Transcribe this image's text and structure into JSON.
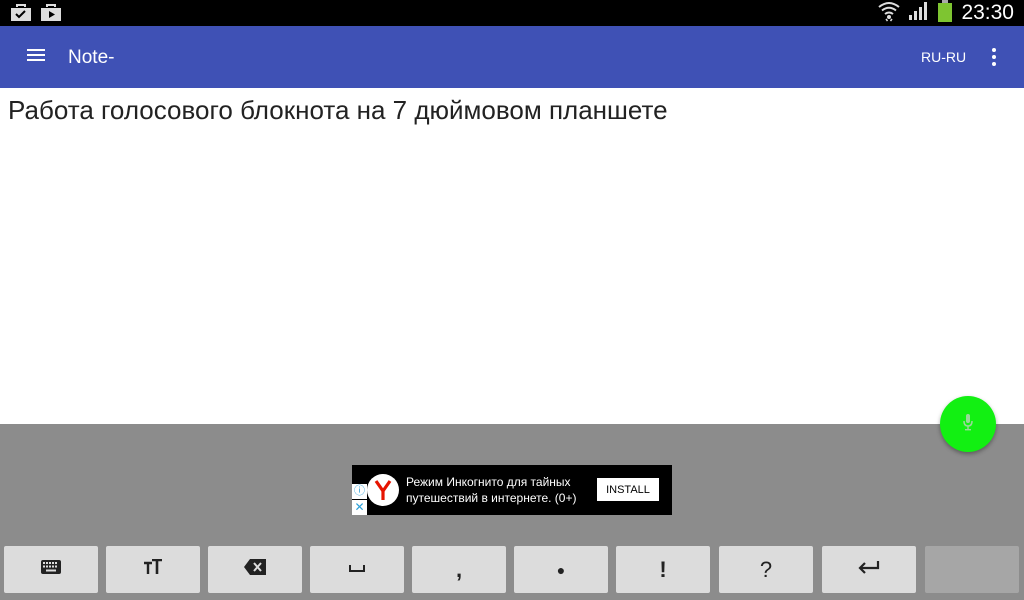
{
  "status_bar": {
    "time": "23:30",
    "icons": [
      "shopping-bag-check-icon",
      "shopping-bag-play-icon",
      "wifi-icon",
      "cellular-signal-icon",
      "battery-icon"
    ]
  },
  "app_bar": {
    "title": "Note-",
    "language": "RU-RU",
    "color": "#3f51b5"
  },
  "note": {
    "text": "Работа голосового блокнота на 7 дюймовом планшете"
  },
  "fab": {
    "icon": "microphone-icon",
    "color": "#12f012"
  },
  "ad": {
    "line1": "Режим Инкогнито для тайных",
    "line2": "путешествий в интернете. (0+)",
    "install_label": "INSTALL",
    "info_glyph": "ⓘ",
    "close_glyph": "✕",
    "logo_letter": "Y",
    "logo_color": "#e61400"
  },
  "toolbar": {
    "keys": [
      {
        "name": "keyboard-key",
        "icon": "keyboard-icon"
      },
      {
        "name": "text-size-key",
        "icon": "text-size-icon"
      },
      {
        "name": "backspace-key",
        "icon": "backspace-icon"
      },
      {
        "name": "space-key",
        "icon": "space-icon"
      },
      {
        "name": "comma-key",
        "label": ","
      },
      {
        "name": "period-key",
        "label": "●"
      },
      {
        "name": "exclamation-key",
        "label": "!"
      },
      {
        "name": "question-key",
        "label": "?"
      },
      {
        "name": "enter-key",
        "icon": "enter-icon"
      },
      {
        "name": "empty-key"
      }
    ]
  }
}
